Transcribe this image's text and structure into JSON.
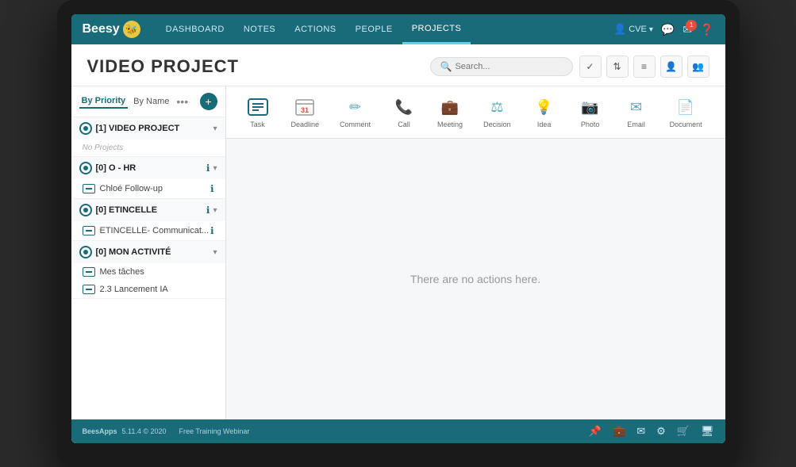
{
  "app": {
    "name": "Beesy",
    "version": "5.11.4 © 2020",
    "training_link": "Free Training Webinar"
  },
  "nav": {
    "links": [
      {
        "label": "DASHBOARD",
        "active": false
      },
      {
        "label": "NOTES",
        "active": false
      },
      {
        "label": "ACTIONS",
        "active": false
      },
      {
        "label": "PEOPLE",
        "active": false
      },
      {
        "label": "PROJECTS",
        "active": true
      }
    ],
    "user": "CVE",
    "notification_count": "1"
  },
  "page": {
    "title": "VIDEO PROJECT",
    "search_placeholder": "Search..."
  },
  "sidebar": {
    "tab_priority": "By Priority",
    "tab_name": "By Name",
    "projects": [
      {
        "id": "p1",
        "label": "[1] VIDEO PROJECT",
        "expanded": true,
        "no_projects_text": "No Projects"
      },
      {
        "id": "p2",
        "label": "[0] O - HR",
        "expanded": true,
        "children": [
          {
            "label": "Chloé Follow-up"
          }
        ]
      },
      {
        "id": "p3",
        "label": "[0] ETINCELLE",
        "expanded": true,
        "children": [
          {
            "label": "ETINCELLE- Communicat..."
          }
        ]
      },
      {
        "id": "p4",
        "label": "[0] MON ACTIVITÉ",
        "expanded": true,
        "children": [
          {
            "label": "Mes tâches"
          },
          {
            "label": "2.3 Lancement IA"
          }
        ]
      }
    ]
  },
  "action_types": [
    {
      "label": "Task",
      "icon": "☑",
      "selected": true
    },
    {
      "label": "Deadline",
      "icon": "31",
      "is_number": true
    },
    {
      "label": "Comment",
      "icon": "✏"
    },
    {
      "label": "Call",
      "icon": "📞"
    },
    {
      "label": "Meeting",
      "icon": "💼"
    },
    {
      "label": "Decision",
      "icon": "⚖"
    },
    {
      "label": "Idea",
      "icon": "💡"
    },
    {
      "label": "Photo",
      "icon": "📷"
    },
    {
      "label": "Email",
      "icon": "✉"
    },
    {
      "label": "Document",
      "icon": "📄"
    }
  ],
  "main_content": {
    "empty_message": "There are no actions here."
  }
}
